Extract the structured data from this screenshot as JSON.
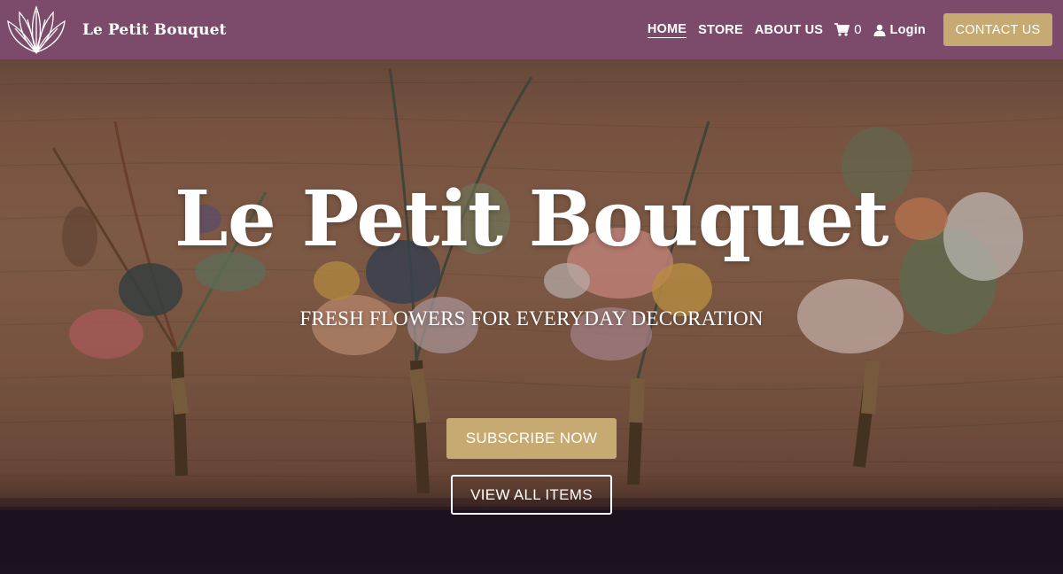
{
  "brand": {
    "name": "Le Petit Bouquet",
    "logo_icon": "lotus-flower-logo"
  },
  "nav": {
    "items": [
      {
        "label": "HOME",
        "active": true
      },
      {
        "label": "STORE",
        "active": false
      },
      {
        "label": "ABOUT US",
        "active": false
      }
    ],
    "cart": {
      "icon": "cart-icon",
      "count": "0"
    },
    "login": {
      "icon": "user-icon",
      "label": "Login"
    },
    "contact_label": "CONTACT US"
  },
  "hero": {
    "title": "Le Petit Bouquet",
    "subtitle": "FRESH FLOWERS FOR EVERYDAY DECORATION",
    "subscribe_label": "SUBSCRIBE NOW",
    "view_label": "VIEW ALL ITEMS"
  },
  "colors": {
    "nav_bg": "#7c4b6c",
    "accent_gold": "#c7aa71",
    "text": "#ffffff",
    "footer_dark": "#1e1320"
  }
}
